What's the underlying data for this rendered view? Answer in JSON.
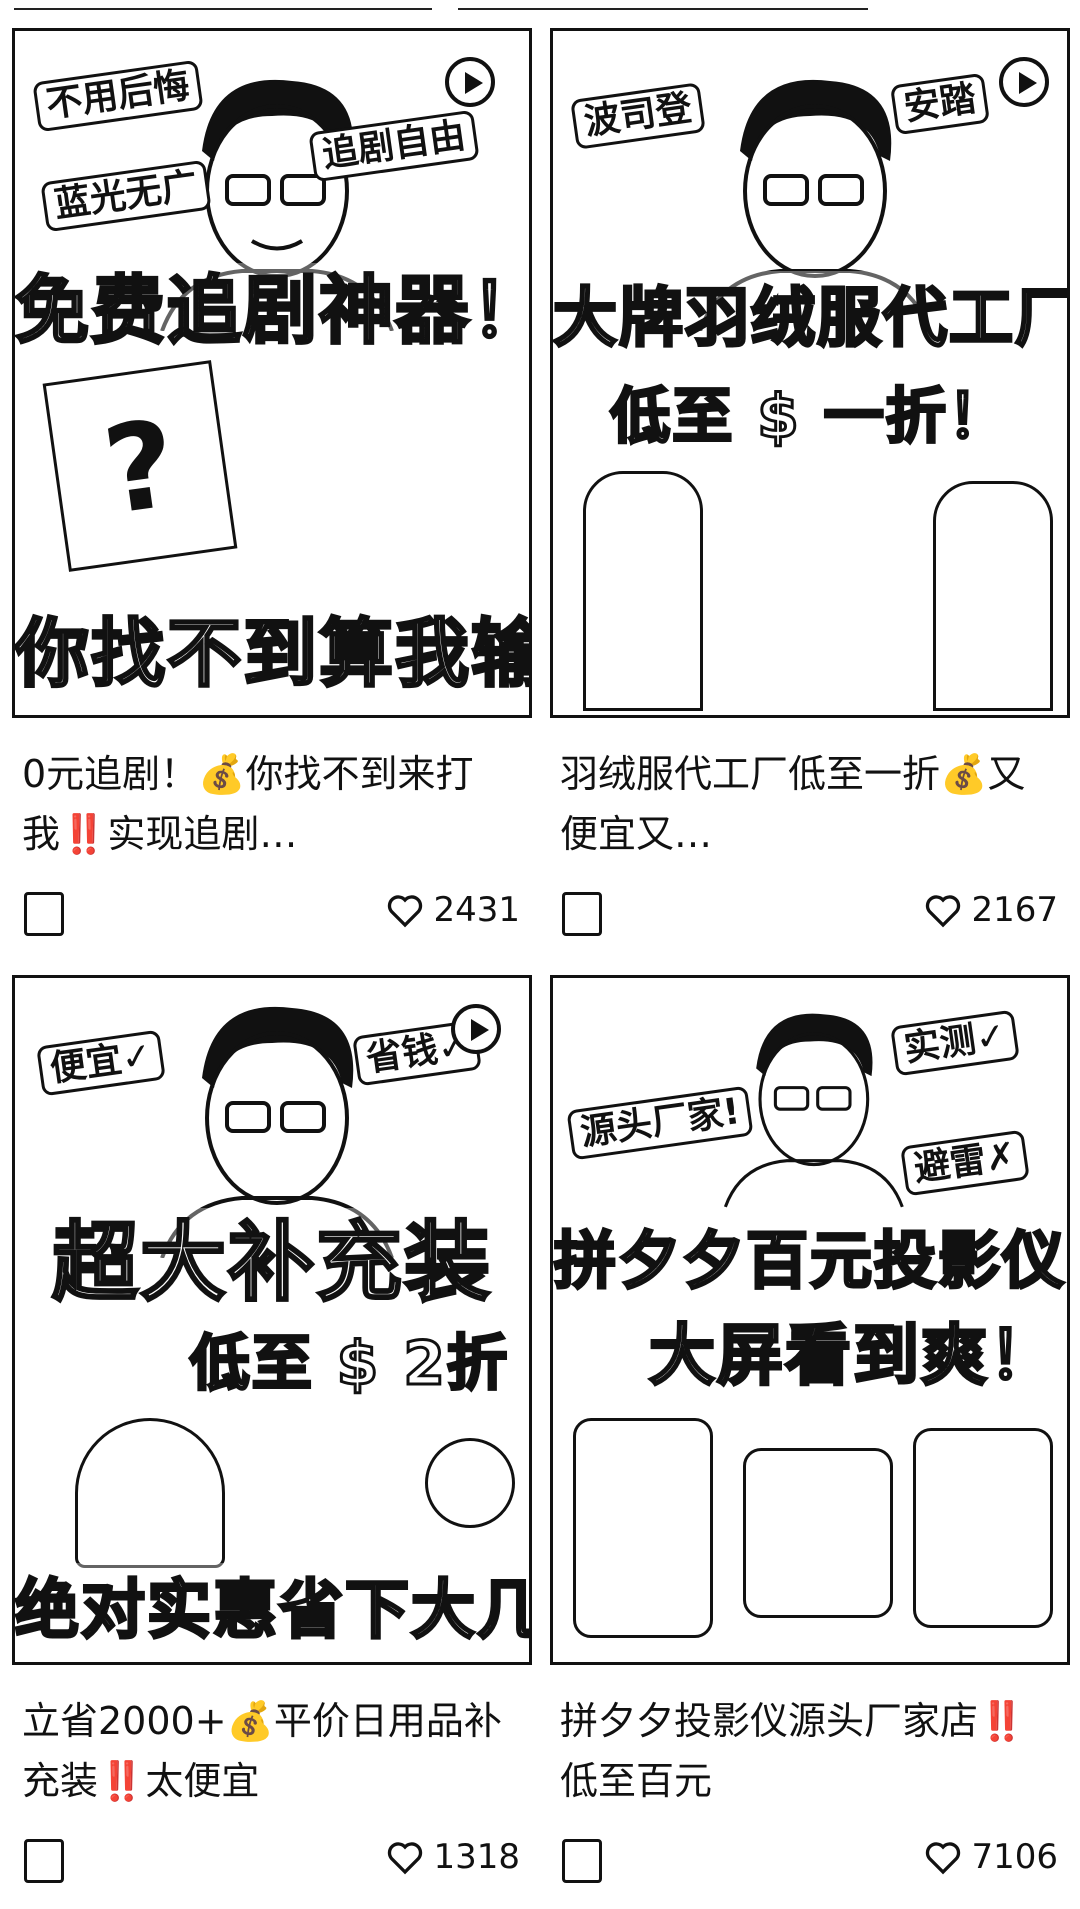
{
  "feed": {
    "cards": [
      {
        "title": "0元追剧！💰你找不到来打我‼️实现追剧…",
        "likes": "2431",
        "stickers": [
          "不用后悔",
          "追剧自由",
          "蓝光无广"
        ],
        "band1": "免费追剧神器！",
        "band2": "你找不到算我输",
        "author": ""
      },
      {
        "title": "羽绒服代工厂低至一折💰又便宜又…",
        "likes": "2167",
        "stickers": [
          "波司登",
          "安踏"
        ],
        "band1": "大牌羽绒服代工厂",
        "band2": "低至 $ 一折！",
        "author": ""
      },
      {
        "title": "立省2000+💰平价日用品补充装‼️太便宜",
        "likes": "1318",
        "stickers": [
          "便宜✓",
          "省钱✓"
        ],
        "band1": "超大补充装",
        "band2": "低至 $ 2折",
        "band3": "绝对实惠省下大几千",
        "author": ""
      },
      {
        "title": "拼夕夕投影仪源头厂家店‼️低至百元",
        "likes": "7106",
        "stickers": [
          "实测✓",
          "源头厂家!",
          "避雷✗"
        ],
        "band1": "拼夕夕百元投影仪",
        "band2": "大屏看到爽！",
        "author": ""
      }
    ]
  },
  "icons": {
    "like": "heart-outline-icon",
    "play": "play-circle-icon",
    "avatar": "author-avatar"
  },
  "colors": {
    "ink": "#111111",
    "background": "#ffffff"
  }
}
